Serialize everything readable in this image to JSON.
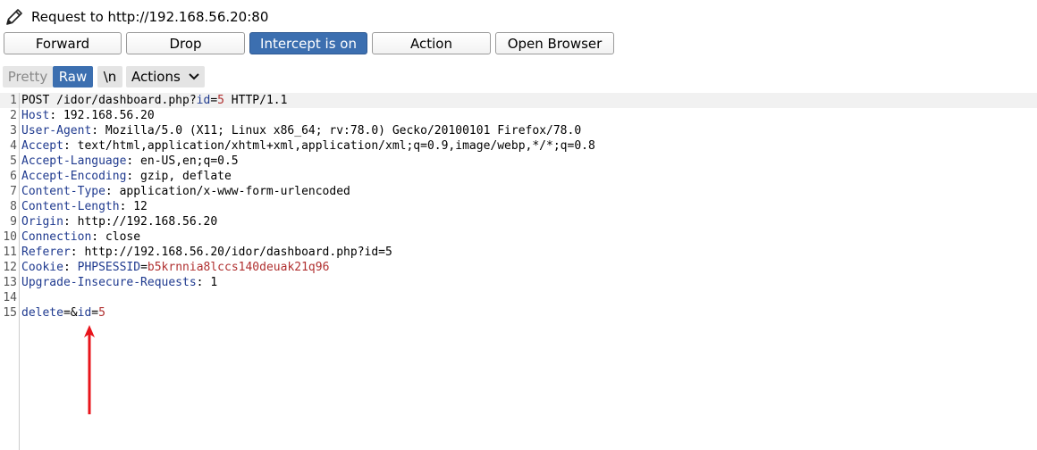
{
  "header": {
    "title": "Request to http://192.168.56.20:80",
    "icon": "pencil-icon"
  },
  "toolbar": {
    "forward": "Forward",
    "drop": "Drop",
    "intercept": "Intercept is on",
    "action": "Action",
    "open_browser": "Open Browser"
  },
  "tabs": {
    "pretty": "Pretty",
    "raw": "Raw",
    "newline": "\\n",
    "actions": "Actions"
  },
  "request": {
    "line1": {
      "num": "1",
      "a": "POST /idor/dashboard.php?",
      "b": "id",
      "c": "=",
      "d": "5",
      "e": " HTTP/1.1"
    },
    "line2": {
      "num": "2",
      "key": "Host",
      "val": ": 192.168.56.20"
    },
    "line3": {
      "num": "3",
      "key": "User-Agent",
      "val": ": Mozilla/5.0 (X11; Linux x86_64; rv:78.0) Gecko/20100101 Firefox/78.0"
    },
    "line4": {
      "num": "4",
      "key": "Accept",
      "val": ": text/html,application/xhtml+xml,application/xml;q=0.9,image/webp,*/*;q=0.8"
    },
    "line5": {
      "num": "5",
      "key": "Accept-Language",
      "val": ": en-US,en;q=0.5"
    },
    "line6": {
      "num": "6",
      "key": "Accept-Encoding",
      "val": ": gzip, deflate"
    },
    "line7": {
      "num": "7",
      "key": "Content-Type",
      "val": ": application/x-www-form-urlencoded"
    },
    "line8": {
      "num": "8",
      "key": "Content-Length",
      "val": ": 12"
    },
    "line9": {
      "num": "9",
      "key": "Origin",
      "val": ": http://192.168.56.20"
    },
    "line10": {
      "num": "10",
      "key": "Connection",
      "val": ": close"
    },
    "line11": {
      "num": "11",
      "key": "Referer",
      "val": ": http://192.168.56.20/idor/dashboard.php?id=5"
    },
    "line12": {
      "num": "12",
      "key": "Cookie",
      "val": ": ",
      "ck": "PHPSESSID",
      "eq": "=",
      "cv": "b5krnnia8lccs140deuak21q96"
    },
    "line13": {
      "num": "13",
      "key": "Upgrade-Insecure-Requests",
      "val": ": 1"
    },
    "line14": {
      "num": "14"
    },
    "line15": {
      "num": "15",
      "a": "delete",
      "b": "=&",
      "c": "id",
      "d": "=",
      "e": "5"
    }
  },
  "colors": {
    "accent": "#3c6fb0",
    "key": "#1f3a8f",
    "value_red": "#b03030",
    "annotation_arrow": "#e8141b"
  }
}
